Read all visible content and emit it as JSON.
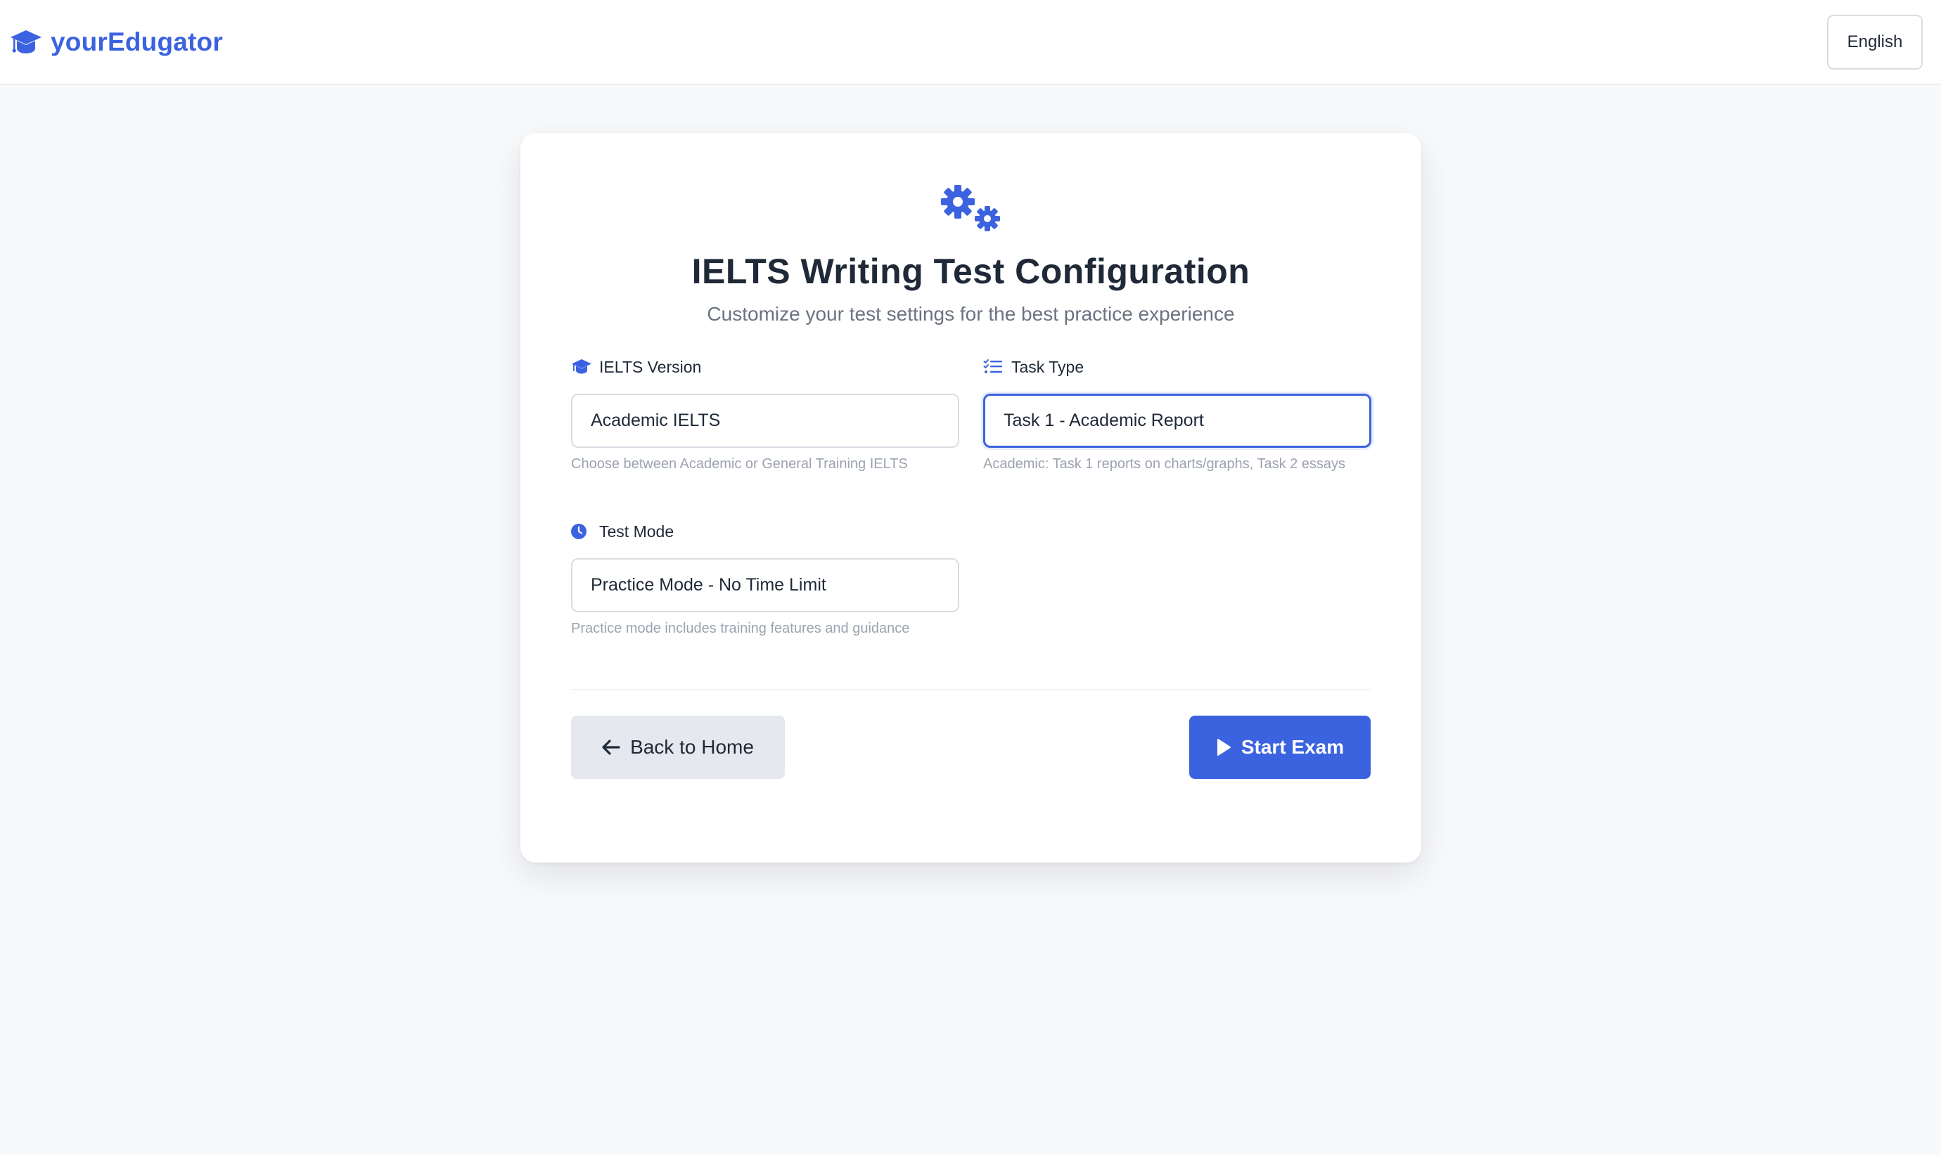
{
  "header": {
    "brand_name": "yourEdugator",
    "brand_icon": "graduation-cap-icon",
    "language_label": "English"
  },
  "card": {
    "icon": "gears-icon",
    "title": "IELTS Writing Test Configuration",
    "subtitle": "Customize your test settings for the best practice experience",
    "fields": {
      "version": {
        "icon": "graduation-cap-icon",
        "label": "IELTS Version",
        "value": "Academic IELTS",
        "hint": "Choose between Academic or General Training IELTS"
      },
      "task_type": {
        "icon": "list-check-icon",
        "label": "Task Type",
        "value": "Task 1 - Academic Report",
        "hint": "Academic: Task 1 reports on charts/graphs, Task 2 essays"
      },
      "test_mode": {
        "icon": "clock-icon",
        "label": "Test Mode",
        "value": "Practice Mode - No Time Limit",
        "hint": "Practice mode includes training features and guidance"
      }
    },
    "actions": {
      "back_label": "Back to Home",
      "back_icon": "arrow-left-icon",
      "start_label": "Start Exam",
      "start_icon": "play-icon"
    }
  },
  "colors": {
    "accent": "#3b63e0",
    "background": "#f8f9fb",
    "text": "#1f2937",
    "muted": "#6b7280",
    "hint": "#9ca3af",
    "secondary_button": "#e5e8ee"
  }
}
